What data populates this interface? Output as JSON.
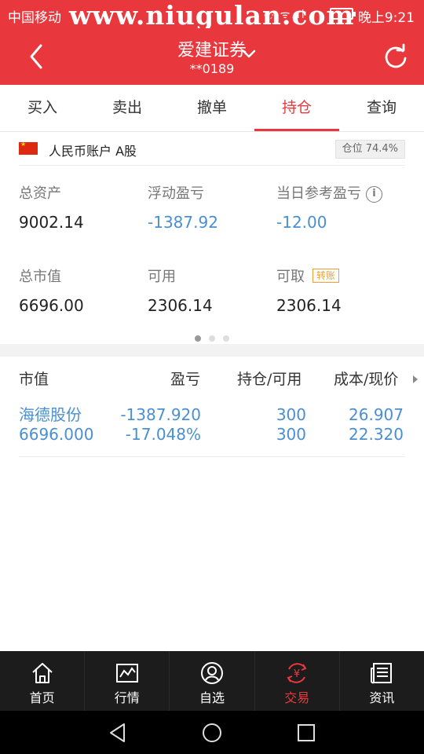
{
  "status_bar": {
    "carrier": "中国移动",
    "watermark": "www.niugulan.com",
    "time": "晚上9:21"
  },
  "header": {
    "title": "爱建证券",
    "account_no": "**0189"
  },
  "tabs": [
    "买入",
    "卖出",
    "撤单",
    "持仓",
    "查询"
  ],
  "active_tab": "持仓",
  "account": {
    "name": "人民币账户 A股",
    "position_label": "仓位 74.4%"
  },
  "summary": {
    "total_assets": {
      "label": "总资产",
      "value": "9002.14"
    },
    "floating_pl": {
      "label": "浮动盈亏",
      "value": "-1387.92"
    },
    "daily_ref_pl": {
      "label": "当日参考盈亏",
      "value": "-12.00"
    },
    "market_value": {
      "label": "总市值",
      "value": "6696.00"
    },
    "available": {
      "label": "可用",
      "value": "2306.14"
    },
    "withdrawable": {
      "label": "可取",
      "value": "2306.14",
      "transfer_tag": "转账"
    }
  },
  "pager": {
    "pages": 3,
    "current": 1
  },
  "holdings": {
    "columns": [
      "市值",
      "盈亏",
      "持仓/可用",
      "成本/现价"
    ],
    "rows": [
      {
        "name": "海德股份",
        "market_value": "6696.000",
        "pl": "-1387.920",
        "pl_pct": "-17.048%",
        "position": "300",
        "available": "300",
        "cost": "26.907",
        "price": "22.320"
      }
    ]
  },
  "bottom_nav": [
    {
      "label": "首页",
      "icon": "home-icon"
    },
    {
      "label": "行情",
      "icon": "chart-icon"
    },
    {
      "label": "自选",
      "icon": "person-icon"
    },
    {
      "label": "交易",
      "icon": "yuan-exchange-icon",
      "active": true
    },
    {
      "label": "资讯",
      "icon": "news-icon"
    }
  ],
  "colors": {
    "brand_red": "#e8383d",
    "value_blue": "#4a8fd2",
    "tag_orange": "#f0a030",
    "nav_dark": "#1c1c1c"
  }
}
